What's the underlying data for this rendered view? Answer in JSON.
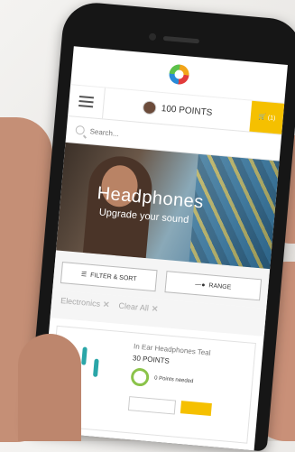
{
  "header": {
    "points_label": "100 POINTS",
    "cart_count": "(1)"
  },
  "search": {
    "placeholder": "Search..."
  },
  "hero": {
    "title": "Headphones",
    "subtitle": "Upgrade your sound"
  },
  "controls": {
    "filter_label": "FILTER & SORT",
    "range_label": "RANGE"
  },
  "filters": {
    "active": "Electronics",
    "clear": "Clear All"
  },
  "product": {
    "name": "In Ear Headphones Teal",
    "points": "30 POINTS",
    "points_needed": "0 Points needed"
  },
  "colors": {
    "accent": "#f5c000",
    "progress": "#8bc34a"
  }
}
